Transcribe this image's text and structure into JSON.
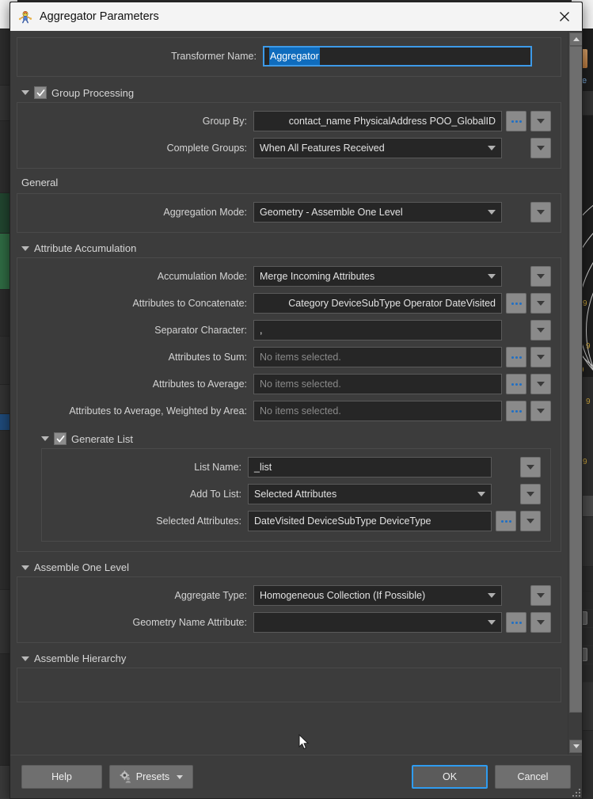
{
  "window": {
    "title": "Aggregator Parameters",
    "icon": "transformer-icon",
    "close_label": "✕"
  },
  "transformer": {
    "label": "Transformer Name:",
    "value": "Aggregator",
    "selected": true
  },
  "sections": {
    "group_processing": {
      "title": "Group Processing",
      "checked": true,
      "rows": [
        {
          "label": "Group By:",
          "value": "contact_name PhysicalAddress POO_GlobalID",
          "type": "text-clipped",
          "has_ellipsis": true,
          "has_dropdown": true
        },
        {
          "label": "Complete Groups:",
          "value": "When All Features Received",
          "type": "combo",
          "has_ellipsis": false,
          "has_dropdown": true
        }
      ]
    },
    "general": {
      "title": "General",
      "rows": [
        {
          "label": "Aggregation Mode:",
          "value": "Geometry - Assemble One Level",
          "type": "combo",
          "has_ellipsis": false,
          "has_dropdown": true
        }
      ]
    },
    "attribute_accumulation": {
      "title": "Attribute Accumulation",
      "rows": [
        {
          "label": "Accumulation Mode:",
          "value": "Merge Incoming Attributes",
          "type": "combo",
          "has_ellipsis": false,
          "has_dropdown": true
        },
        {
          "label": "Attributes to Concatenate:",
          "value": "Category DeviceSubType Operator DateVisited",
          "type": "text-clipped",
          "has_ellipsis": true,
          "has_dropdown": true
        },
        {
          "label": "Separator Character:",
          "value": ",",
          "type": "text",
          "has_ellipsis": false,
          "has_dropdown": true
        },
        {
          "label": "Attributes to Sum:",
          "value": "",
          "placeholder": "No items selected.",
          "type": "text",
          "has_ellipsis": true,
          "has_dropdown": true
        },
        {
          "label": "Attributes to Average:",
          "value": "",
          "placeholder": "No items selected.",
          "type": "text",
          "has_ellipsis": true,
          "has_dropdown": true
        },
        {
          "label": "Attributes to Average, Weighted by Area:",
          "value": "",
          "placeholder": "No items selected.",
          "type": "text",
          "has_ellipsis": true,
          "has_dropdown": true
        }
      ]
    },
    "generate_list": {
      "title": "Generate List",
      "checked": true,
      "rows": [
        {
          "label": "List Name:",
          "value": "_list",
          "type": "text",
          "has_ellipsis": false,
          "has_dropdown": true
        },
        {
          "label": "Add To List:",
          "value": "Selected Attributes",
          "type": "combo",
          "has_ellipsis": false,
          "has_dropdown": true
        },
        {
          "label": "Selected Attributes:",
          "value": "DateVisited DeviceSubType DeviceType",
          "type": "text",
          "has_ellipsis": true,
          "has_dropdown": true
        }
      ]
    },
    "assemble_one_level": {
      "title": "Assemble One Level",
      "rows": [
        {
          "label": "Aggregate Type:",
          "value": "Homogeneous Collection (If Possible)",
          "type": "combo",
          "has_ellipsis": false,
          "has_dropdown": true
        },
        {
          "label": "Geometry Name Attribute:",
          "value": "",
          "type": "combo",
          "has_ellipsis": true,
          "has_dropdown": true
        }
      ]
    },
    "assemble_hierarchy": {
      "title": "Assemble Hierarchy"
    }
  },
  "footer": {
    "help": "Help",
    "presets": "Presets",
    "ok": "OK",
    "cancel": "Cancel"
  },
  "colors": {
    "accent": "#3d9ae8",
    "selection": "#0f6cbd",
    "dialog_bg": "#3c3c3c",
    "field_bg": "#262626",
    "titlebar_bg": "#f4f4f4"
  },
  "background": {
    "right_labels": [
      "Re"
    ],
    "contour_values": [
      "9",
      "9",
      "9",
      "9",
      "9",
      "9",
      "9",
      "9"
    ]
  }
}
